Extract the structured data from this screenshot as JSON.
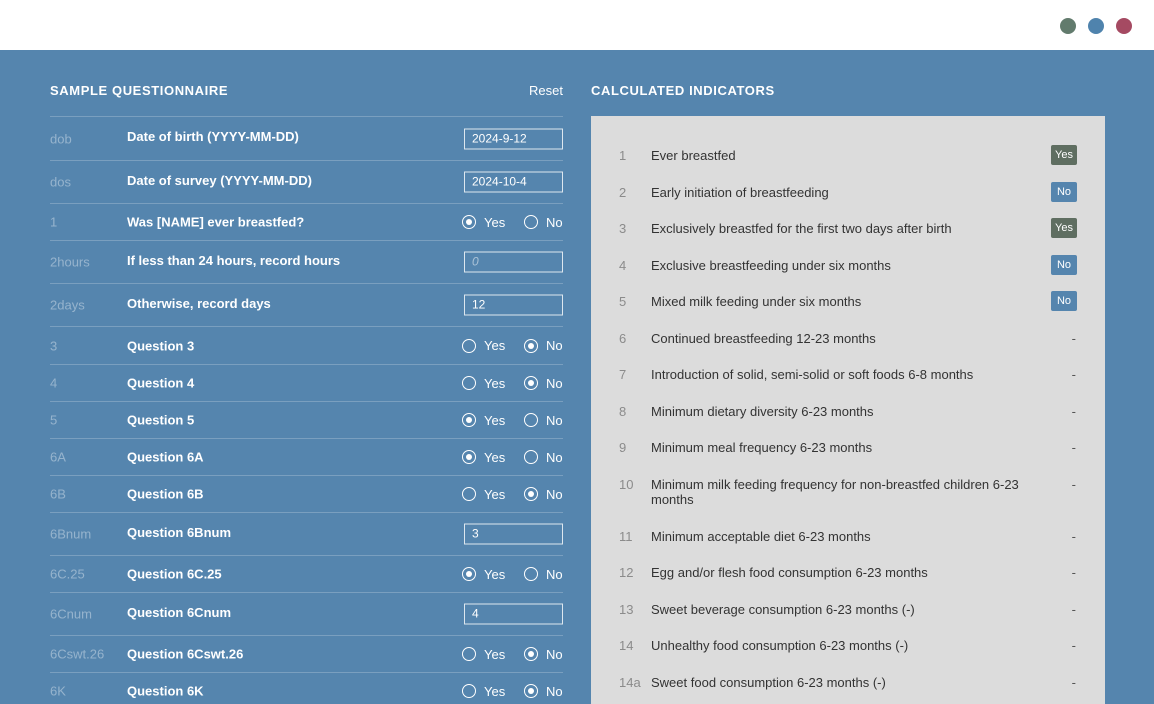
{
  "window_controls": {
    "dot_colors": [
      "#627b6d",
      "#4f83ad",
      "#a54a62"
    ]
  },
  "questionnaire": {
    "title": "SAMPLE QUESTIONNAIRE",
    "reset_label": "Reset",
    "rows": [
      {
        "code": "dob",
        "label": "Date of birth (YYYY-MM-DD)",
        "type": "text",
        "value": "2024-9-12",
        "placeholder": ""
      },
      {
        "code": "dos",
        "label": "Date of survey (YYYY-MM-DD)",
        "type": "text",
        "value": "2024-10-4",
        "placeholder": ""
      },
      {
        "code": "1",
        "label": "Was [NAME] ever breastfed?",
        "type": "radio",
        "selected": "Yes"
      },
      {
        "code": "2hours",
        "label": "If less than 24 hours, record hours",
        "type": "text",
        "value": "",
        "placeholder": "0"
      },
      {
        "code": "2days",
        "label": "Otherwise, record days",
        "type": "text",
        "value": "12",
        "placeholder": ""
      },
      {
        "code": "3",
        "label": "Question 3",
        "type": "radio",
        "selected": "No"
      },
      {
        "code": "4",
        "label": "Question 4",
        "type": "radio",
        "selected": "No"
      },
      {
        "code": "5",
        "label": "Question 5",
        "type": "radio",
        "selected": "Yes"
      },
      {
        "code": "6A",
        "label": "Question 6A",
        "type": "radio",
        "selected": "Yes"
      },
      {
        "code": "6B",
        "label": "Question 6B",
        "type": "radio",
        "selected": "No"
      },
      {
        "code": "6Bnum",
        "label": "Question 6Bnum",
        "type": "text",
        "value": "3",
        "placeholder": ""
      },
      {
        "code": "6C.25",
        "label": "Question 6C.25",
        "type": "radio",
        "selected": "Yes"
      },
      {
        "code": "6Cnum",
        "label": "Question 6Cnum",
        "type": "text",
        "value": "4",
        "placeholder": ""
      },
      {
        "code": "6Cswt.26",
        "label": "Question 6Cswt.26",
        "type": "radio",
        "selected": "No"
      },
      {
        "code": "6K",
        "label": "Question 6K",
        "type": "radio",
        "selected": "No"
      }
    ],
    "yes_label": "Yes",
    "no_label": "No"
  },
  "indicators": {
    "title": "CALCULATED INDICATORS",
    "badge_colors": {
      "yes": "#5f6e61",
      "no": "#5585ae"
    },
    "items": [
      {
        "num": "1",
        "text": "Ever breastfed",
        "result": "Yes"
      },
      {
        "num": "2",
        "text": "Early initiation of breastfeeding",
        "result": "No"
      },
      {
        "num": "3",
        "text": "Exclusively breastfed for the first two days after birth",
        "result": "Yes"
      },
      {
        "num": "4",
        "text": "Exclusive breastfeeding under six months",
        "result": "No"
      },
      {
        "num": "5",
        "text": "Mixed milk feeding under six months",
        "result": "No"
      },
      {
        "num": "6",
        "text": "Continued breastfeeding 12-23 months",
        "result": "-"
      },
      {
        "num": "7",
        "text": "Introduction of solid, semi-solid or soft foods 6-8 months",
        "result": "-"
      },
      {
        "num": "8",
        "text": "Minimum dietary diversity 6-23 months",
        "result": "-"
      },
      {
        "num": "9",
        "text": "Minimum meal frequency 6-23 months",
        "result": "-"
      },
      {
        "num": "10",
        "text": "Minimum milk feeding frequency for non-breastfed children 6-23 months",
        "result": "-"
      },
      {
        "num": "11",
        "text": "Minimum acceptable diet 6-23 months",
        "result": "-"
      },
      {
        "num": "12",
        "text": "Egg and/or flesh food consumption 6-23 months",
        "result": "-"
      },
      {
        "num": "13",
        "text": "Sweet beverage consumption 6-23 months (-)",
        "result": "-"
      },
      {
        "num": "14",
        "text": "Unhealthy food consumption 6-23 months (-)",
        "result": "-"
      },
      {
        "num": "14a",
        "text": "Sweet food consumption 6-23 months (-)",
        "result": "-"
      }
    ]
  }
}
